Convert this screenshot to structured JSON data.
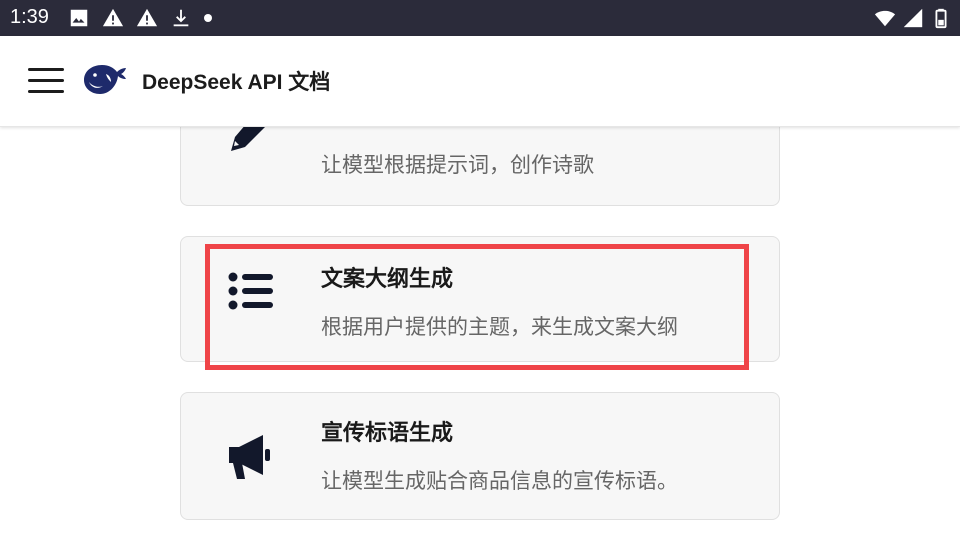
{
  "status_bar": {
    "time": "1:39",
    "left_icons": [
      "image-icon",
      "warning-icon",
      "warning-icon",
      "download-icon",
      "dot-icon"
    ],
    "right_icons": [
      "wifi-icon",
      "signal-icon",
      "battery-icon"
    ]
  },
  "app_bar": {
    "title": "DeepSeek API 文档",
    "logo": "deepseek-whale-logo",
    "menu_icon": "hamburger-menu-icon",
    "logo_color": "#1e2a6b"
  },
  "cards": [
    {
      "title": "",
      "description": "让模型根据提示词，创作诗歌",
      "icon": "pen-icon"
    },
    {
      "title": "文案大纲生成",
      "description": "根据用户提供的主题，来生成文案大纲",
      "icon": "list-icon",
      "highlighted": true
    },
    {
      "title": "宣传标语生成",
      "description": "让模型生成贴合商品信息的宣传标语。",
      "icon": "megaphone-icon"
    }
  ],
  "colors": {
    "status_bar_bg": "#2b2b3a",
    "card_bg": "#f7f7f7",
    "highlight_border": "#ef4448",
    "icon_color": "#12182b"
  }
}
